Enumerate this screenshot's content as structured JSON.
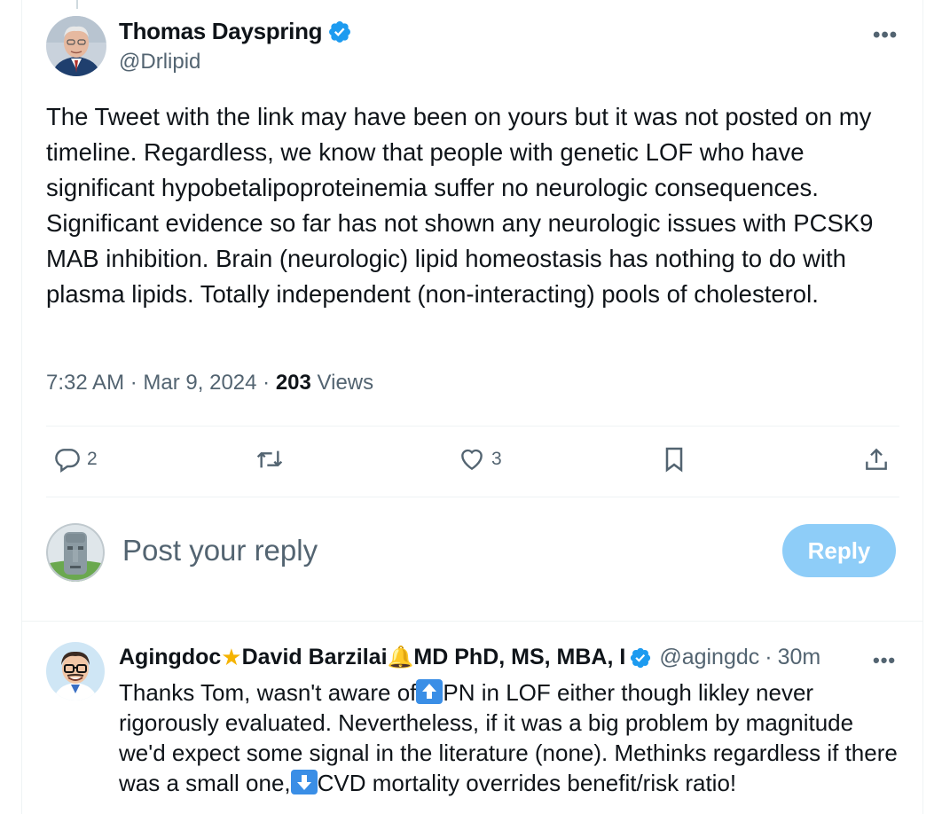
{
  "tweet": {
    "author_name": "Thomas Dayspring",
    "author_handle": "@Drlipid",
    "more_label": "•••",
    "text": "The Tweet with the link may have been on yours but it was not posted on my timeline. Regardless, we know that people with genetic LOF who have significant hypobetalipoproteinemia suffer no neurologic consequences. Significant evidence so far has not shown any neurologic issues with PCSK9 MAB inhibition. Brain (neurologic) lipid homeostasis has nothing to do with plasma lipids. Totally independent (non-interacting) pools of cholesterol.",
    "time": "7:32 AM",
    "date": "Mar 9, 2024",
    "views_count": "203",
    "views_label": "Views",
    "separator": "·"
  },
  "actions": {
    "reply_count": "2",
    "retweet_count": "",
    "like_count": "3"
  },
  "composer": {
    "placeholder": "Post your reply",
    "button_label": "Reply"
  },
  "reply": {
    "name_part1": "Agingdoc",
    "name_part2": "David Barzilai",
    "name_part3": "MD PhD, MS, MBA, I",
    "handle": "@agingdc",
    "separator": "·",
    "time": "30m",
    "more_label": "•••",
    "text_1": "Thanks Tom, wasn't aware of",
    "text_2": "PN in LOF either though likley never rigorously evaluated. Nevertheless, if it was a big problem by magnitude we'd expect some signal in the literature (none). Methinks regardless if there was a small one,",
    "text_3": "CVD mortality overrides benefit/risk ratio!",
    "star_emoji": "★",
    "bell_emoji": "🔔"
  },
  "colors": {
    "verified_blue": "#1d9bf0",
    "secondary_text": "#536471",
    "reply_button_disabled": "#8ecdf8"
  }
}
